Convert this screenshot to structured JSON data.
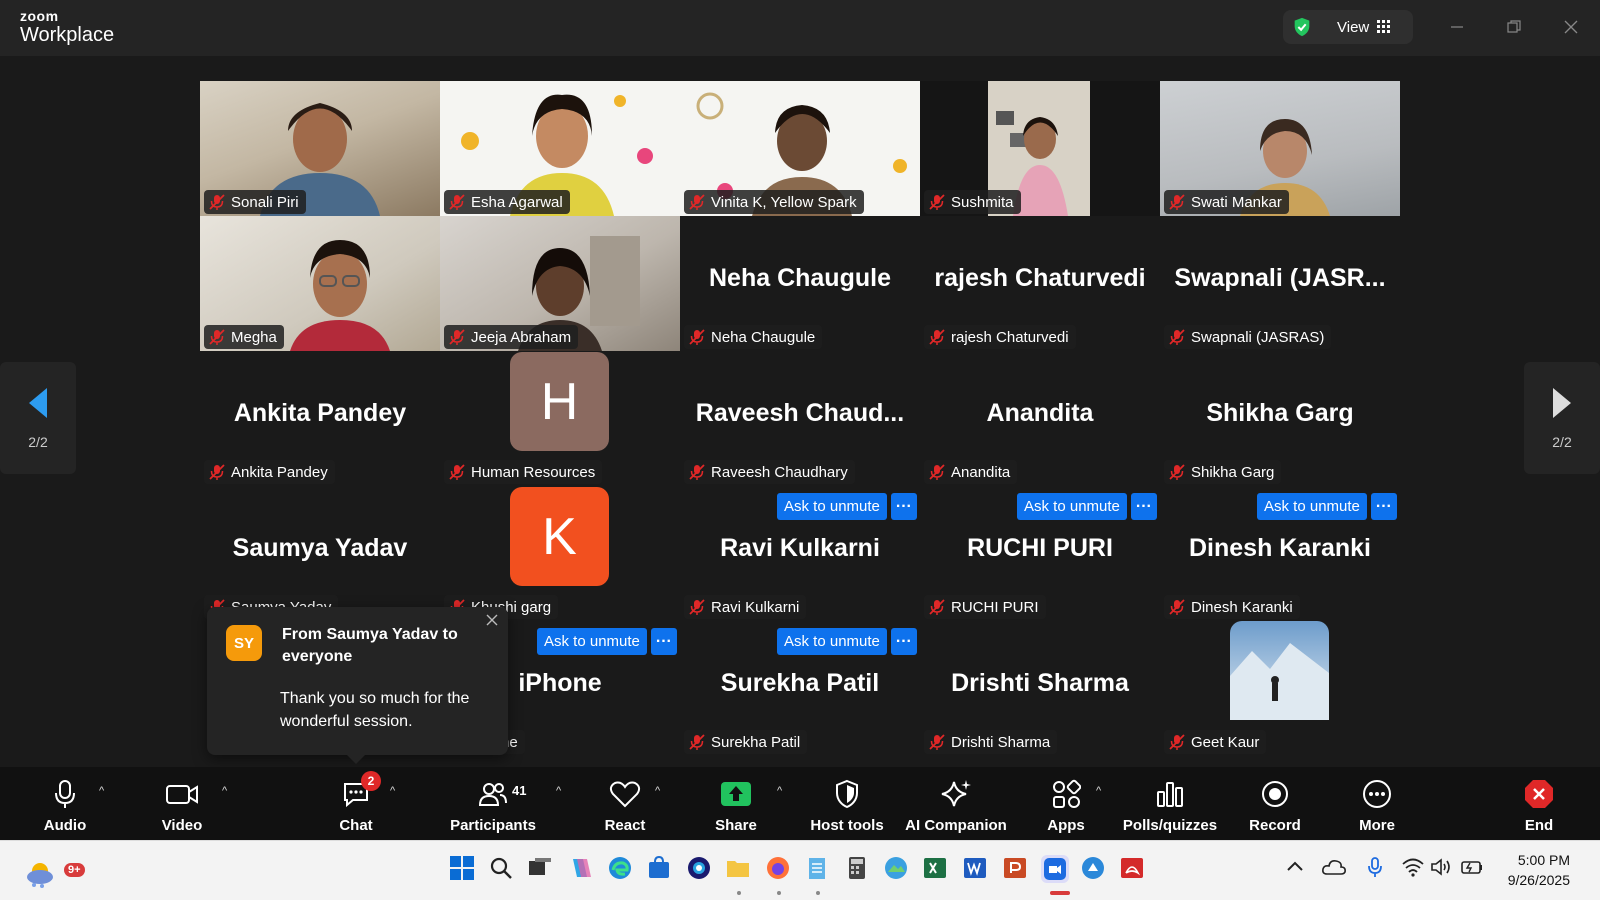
{
  "app": {
    "logo_small": "zoom",
    "logo_big": "Workplace",
    "view_label": "View"
  },
  "colors": {
    "accent": "#0e72ed",
    "mute_red": "#e02828",
    "toast_avatar": "#f59a0b",
    "avatar_H": "#8b6a60",
    "avatar_K": "#f2501f"
  },
  "gallery": {
    "page_indicator_left": "2/2",
    "page_indicator_right": "2/2",
    "ask_label": "Ask to unmute",
    "more_label": "···",
    "tiles": [
      {
        "name": "Sonali Piri",
        "display": "",
        "kind": "video"
      },
      {
        "name": "Esha Agarwal",
        "display": "",
        "kind": "video"
      },
      {
        "name": "Vinita K, Yellow Spark",
        "display": "",
        "kind": "video"
      },
      {
        "name": "Sushmita",
        "display": "",
        "kind": "video"
      },
      {
        "name": "Swati Mankar",
        "display": "",
        "kind": "video"
      },
      {
        "name": "Megha",
        "display": "",
        "kind": "video"
      },
      {
        "name": "Jeeja Abraham",
        "display": "",
        "kind": "video"
      },
      {
        "name": "Neha Chaugule",
        "display": "Neha Chaugule",
        "kind": "name"
      },
      {
        "name": "rajesh Chaturvedi",
        "display": "rajesh Chaturvedi",
        "kind": "name"
      },
      {
        "name": "Swapnali (JASRAS)",
        "display": "Swapnali  (JASR...",
        "kind": "name"
      },
      {
        "name": "Ankita Pandey",
        "display": "Ankita Pandey",
        "kind": "name"
      },
      {
        "name": "Human Resources",
        "display": "H",
        "kind": "avatar"
      },
      {
        "name": "Raveesh Chaudhary",
        "display": "Raveesh  Chaud...",
        "kind": "name"
      },
      {
        "name": "Anandita",
        "display": "Anandita",
        "kind": "name"
      },
      {
        "name": "Shikha Garg",
        "display": "Shikha Garg",
        "kind": "name"
      },
      {
        "name": "Saumya Yadav",
        "display": "Saumya Yadav",
        "kind": "name"
      },
      {
        "name": "Khushi garg",
        "display": "K",
        "kind": "avatar"
      },
      {
        "name": "Ravi Kulkarni",
        "display": "Ravi Kulkarni",
        "kind": "name"
      },
      {
        "name": "RUCHI PURI",
        "display": "RUCHI PURI",
        "kind": "name"
      },
      {
        "name": "Dinesh Karanki",
        "display": "Dinesh Karanki",
        "kind": "name"
      },
      {
        "name": "iPhone",
        "display": "iPhone",
        "kind": "name"
      },
      {
        "name": "Surekha Patil",
        "display": "Surekha Patil",
        "kind": "name"
      },
      {
        "name": "Drishti Sharma",
        "display": "Drishti Sharma",
        "kind": "name"
      },
      {
        "name": "Geet Kaur",
        "display": "",
        "kind": "photo"
      }
    ]
  },
  "chat_toast": {
    "avatar_initials": "SY",
    "from": "From Saumya Yadav to everyone",
    "message": "Thank you so much for the wonderful session."
  },
  "toolbar": {
    "audio": "Audio",
    "video": "Video",
    "chat": "Chat",
    "chat_badge": "2",
    "participants": "Participants",
    "participants_count": "41",
    "react": "React",
    "share": "Share",
    "host_tools": "Host tools",
    "ai_companion": "AI Companion",
    "apps": "Apps",
    "polls": "Polls/quizzes",
    "record": "Record",
    "more": "More",
    "end": "End"
  },
  "taskbar": {
    "weather_badge": "9+",
    "time": "5:00 PM",
    "date": "9/26/2025",
    "icons": [
      "weather-icon",
      "windows-start-icon",
      "search-icon",
      "task-view-icon",
      "copilot-icon",
      "edge-icon",
      "store-icon",
      "chrome-icon",
      "file-explorer-icon",
      "firefox-icon",
      "notepad-icon",
      "calculator-icon",
      "photos-icon",
      "excel-icon",
      "word-icon",
      "powerpoint-icon",
      "zoom-icon",
      "messaging-icon",
      "acrobat-icon"
    ]
  }
}
